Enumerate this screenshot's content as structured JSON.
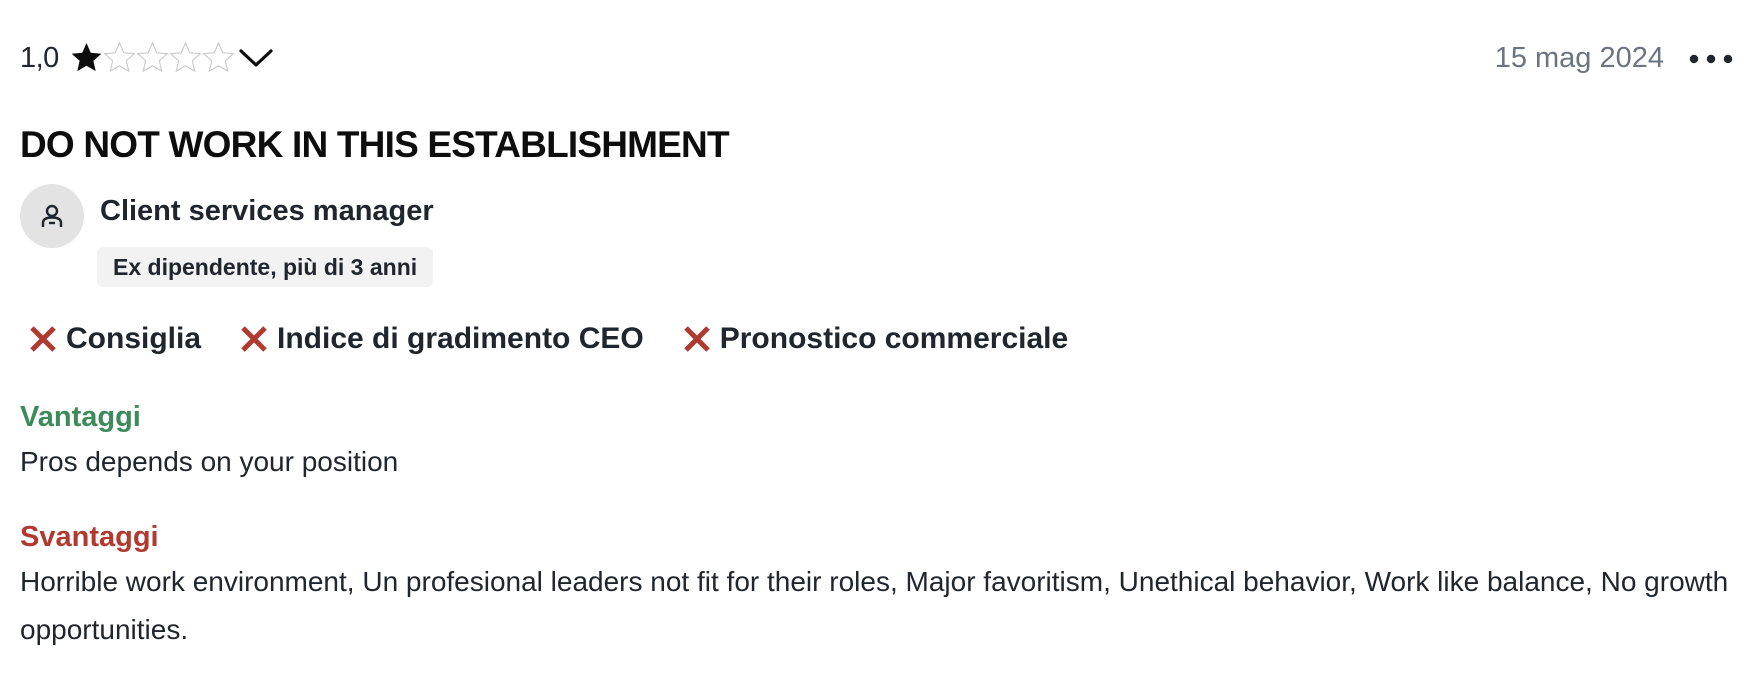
{
  "review": {
    "rating": "1,0",
    "rating_stars": 1,
    "max_stars": 5,
    "date": "15 mag 2024",
    "title": "DO NOT WORK IN THIS ESTABLISHMENT",
    "job_title": "Client services manager",
    "employment_status": "Ex dipendente, più di 3 anni",
    "flags": [
      {
        "label": "Consiglia",
        "value": "no"
      },
      {
        "label": "Indice di gradimento CEO",
        "value": "no"
      },
      {
        "label": "Pronostico commerciale",
        "value": "no"
      }
    ],
    "pros_heading": "Vantaggi",
    "pros_text": "Pros depends on your position",
    "cons_heading": "Svantaggi",
    "cons_text": "Horrible work environment, Un profesional leaders not fit for their roles, Major favoritism, Unethical behavior, Work like balance, No growth opportunities."
  },
  "icons": {
    "star_filled": "star-filled-icon",
    "star_empty": "star-outline-icon",
    "chevron": "chevron-down-icon",
    "more": "more-horizontal-icon",
    "avatar": "person-icon",
    "flag_negative": "x-icon"
  },
  "colors": {
    "pros": "#3d8b5a",
    "cons": "#b03a30",
    "negative_flag": "#b03a30",
    "date": "#6b7480"
  }
}
